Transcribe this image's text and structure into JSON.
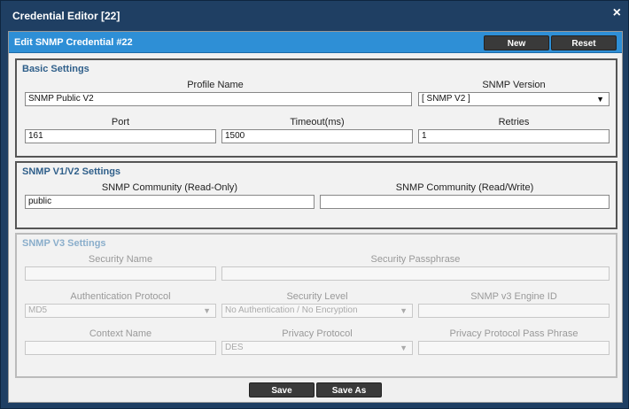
{
  "window": {
    "title": "Credential Editor [22]",
    "close_icon": "×"
  },
  "panel": {
    "title": "Edit SNMP Credential #22",
    "new_label": "New",
    "reset_label": "Reset"
  },
  "basic": {
    "title": "Basic Settings",
    "profile_name_label": "Profile Name",
    "profile_name_value": "SNMP Public V2",
    "snmp_version_label": "SNMP Version",
    "snmp_version_value": "[ SNMP V2 ]",
    "port_label": "Port",
    "port_value": "161",
    "timeout_label": "Timeout(ms)",
    "timeout_value": "1500",
    "retries_label": "Retries",
    "retries_value": "1"
  },
  "v1v2": {
    "title": "SNMP V1/V2 Settings",
    "ro_label": "SNMP Community (Read-Only)",
    "ro_value": "public",
    "rw_label": "SNMP Community (Read/Write)",
    "rw_value": ""
  },
  "v3": {
    "title": "SNMP V3 Settings",
    "security_name_label": "Security Name",
    "security_passphrase_label": "Security Passphrase",
    "auth_protocol_label": "Authentication Protocol",
    "auth_protocol_value": "MD5",
    "security_level_label": "Security Level",
    "security_level_value": "No Authentication / No Encryption",
    "engine_id_label": "SNMP v3 Engine ID",
    "context_name_label": "Context Name",
    "privacy_protocol_label": "Privacy Protocol",
    "privacy_protocol_value": "DES",
    "privacy_pass_label": "Privacy Protocol Pass Phrase"
  },
  "footer": {
    "save_label": "Save",
    "save_as_label": "Save As"
  }
}
